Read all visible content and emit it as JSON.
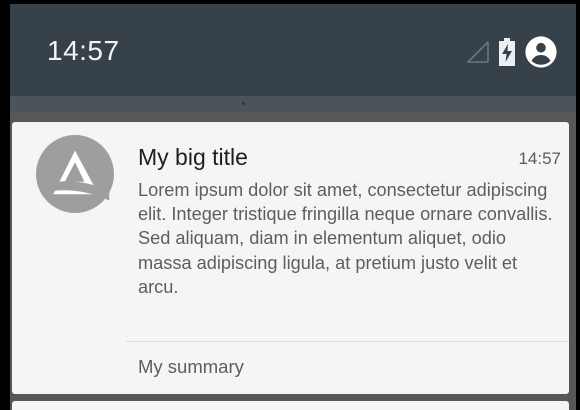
{
  "status_bar": {
    "time": "14:57",
    "icons": [
      "signal-empty-icon",
      "battery-charging-icon",
      "account-circle-icon"
    ]
  },
  "notification": {
    "app_icon": "app-logo-icon",
    "title": "My big title",
    "time": "14:57",
    "text": "Lorem ipsum dolor sit amet, consectetur adipiscing elit. Integer tristique fringilla neque ornare convallis. Sed aliquam, diam in elementum aliquet, odio massa adipiscing ligula, at pretium justo velit et arcu.",
    "summary": "My summary"
  },
  "colors": {
    "status_bar_bg": "#37414a",
    "notification_bg": "#f5f5f5",
    "logo_gray": "#9e9e9e"
  }
}
